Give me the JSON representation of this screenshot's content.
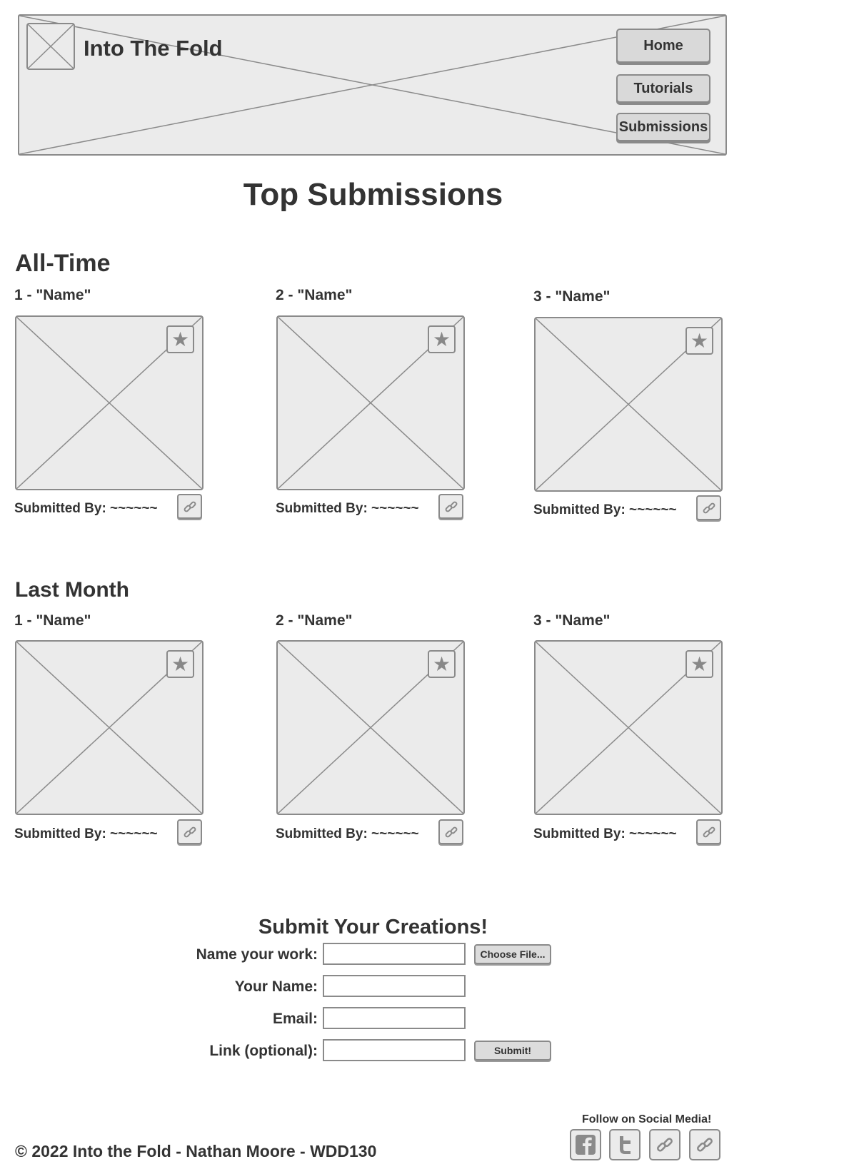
{
  "header": {
    "site_title": "Into The Fold",
    "nav": [
      {
        "label": "Home"
      },
      {
        "label": "Tutorials"
      },
      {
        "label": "Submissions"
      }
    ]
  },
  "page_title": "Top Submissions",
  "sections": [
    {
      "title": "All-Time",
      "items": [
        {
          "rank_label": "1 - \"Name\"",
          "submitted_by": "Submitted By: ~~~~~~"
        },
        {
          "rank_label": "2 - \"Name\"",
          "submitted_by": "Submitted By: ~~~~~~"
        },
        {
          "rank_label": "3 - \"Name\"",
          "submitted_by": "Submitted By: ~~~~~~"
        }
      ]
    },
    {
      "title": "Last Month",
      "items": [
        {
          "rank_label": "1 - \"Name\"",
          "submitted_by": "Submitted By: ~~~~~~"
        },
        {
          "rank_label": "2 - \"Name\"",
          "submitted_by": "Submitted By: ~~~~~~"
        },
        {
          "rank_label": "3 - \"Name\"",
          "submitted_by": "Submitted By: ~~~~~~"
        }
      ]
    }
  ],
  "form": {
    "title": "Submit Your Creations!",
    "fields": [
      {
        "label": "Name your work:",
        "value": ""
      },
      {
        "label": "Your Name:",
        "value": ""
      },
      {
        "label": "Email:",
        "value": ""
      },
      {
        "label": "Link (optional):",
        "value": ""
      }
    ],
    "choose_file_label": "Choose File...",
    "submit_label": "Submit!"
  },
  "footer": {
    "social_label": "Follow on Social Media!",
    "social_icons": [
      "facebook-icon",
      "twitter-icon",
      "link-icon",
      "link-icon"
    ],
    "copyright": "© 2022 Into the Fold - Nathan Moore - WDD130"
  },
  "colors": {
    "placeholder_fill": "#ebebeb",
    "stroke": "#8a8a8a",
    "text": "#333333"
  }
}
